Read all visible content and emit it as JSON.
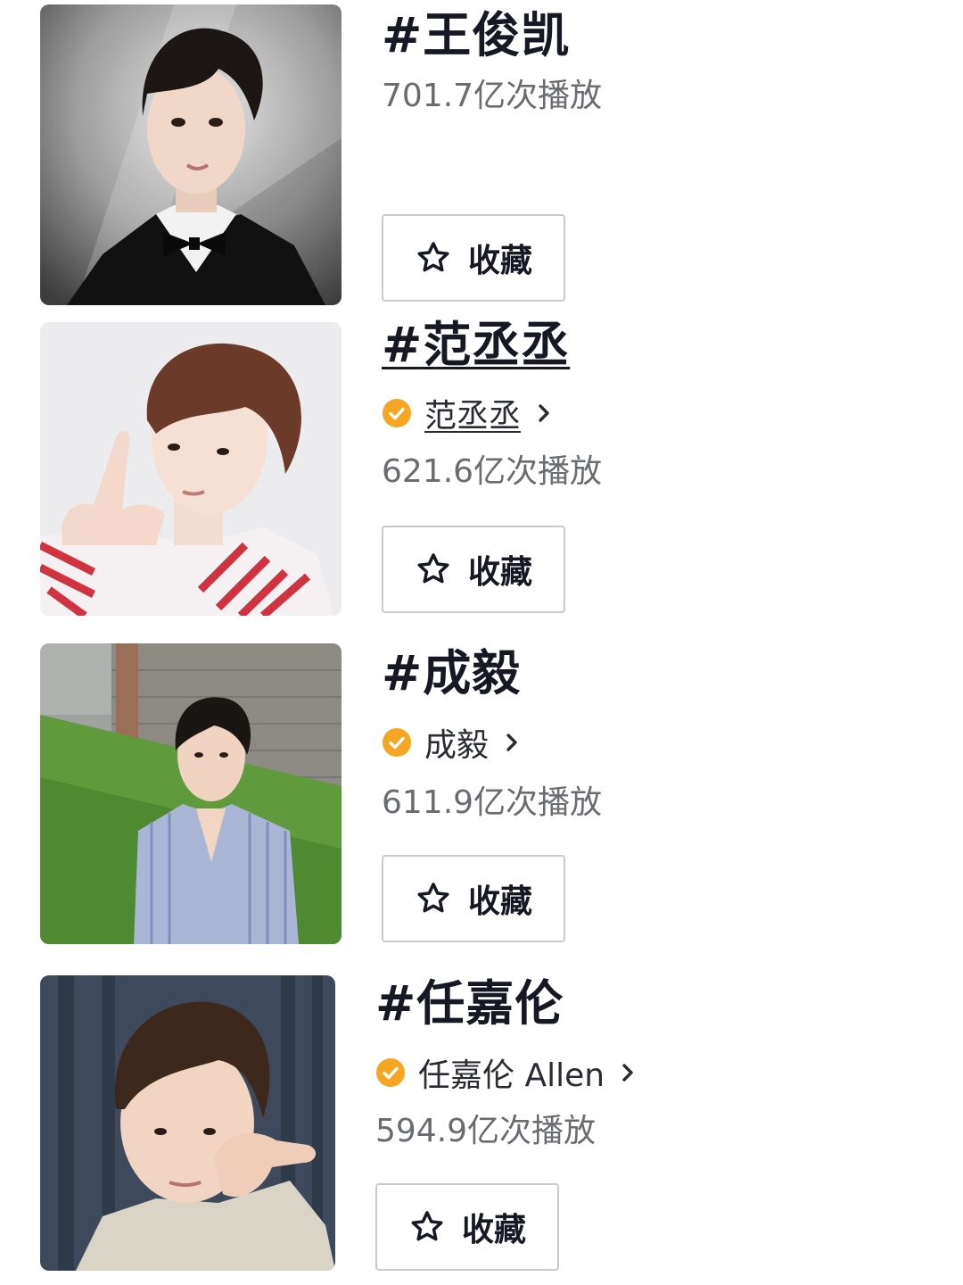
{
  "entries": [
    {
      "title": "#王俊凯",
      "account": null,
      "plays": "701.7亿次播放",
      "favorite_label": "收藏"
    },
    {
      "title": "#范丞丞",
      "account": "范丞丞",
      "plays": "621.6亿次播放",
      "favorite_label": "收藏"
    },
    {
      "title": "#成毅",
      "account": "成毅",
      "plays": "611.9亿次播放",
      "favorite_label": "收藏"
    },
    {
      "title": "#任嘉伦",
      "account": "任嘉伦 Allen",
      "plays": "594.9亿次播放",
      "favorite_label": "收藏"
    }
  ],
  "colors": {
    "verified_badge": "#f6a623",
    "play_count_text": "#6b6c72",
    "button_border": "#c9cacd"
  },
  "icons": {
    "verified": "verified-badge-icon",
    "chevron": "chevron-right-icon",
    "favorite": "star-outline-icon"
  }
}
